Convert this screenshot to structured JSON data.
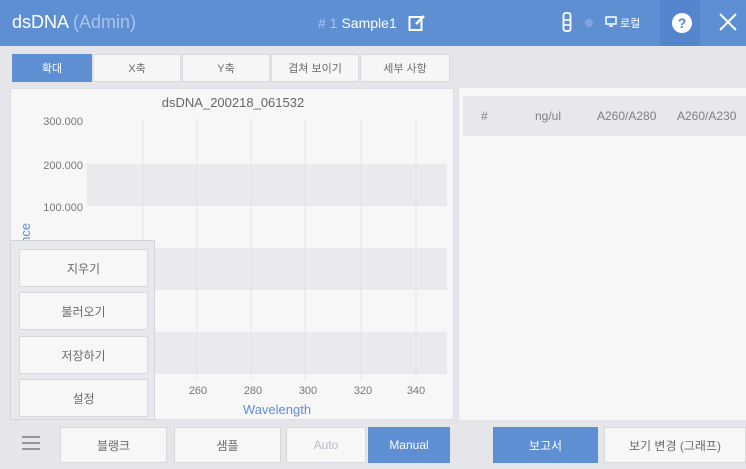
{
  "header": {
    "app_name": "dsDNA",
    "role": " (Admin)",
    "sample_number": "# 1",
    "sample_name": "Sample1",
    "remote_label": "로컬"
  },
  "toolbar": {
    "tabs": [
      {
        "label": "확대",
        "active": true
      },
      {
        "label": "X축",
        "active": false
      },
      {
        "label": "Y축",
        "active": false
      },
      {
        "label": "겹쳐 보이기",
        "active": false
      },
      {
        "label": "세부 사항",
        "active": false
      }
    ]
  },
  "chart_data": {
    "type": "line",
    "title": "dsDNA_200218_061532",
    "xlabel": "Wavelength",
    "ylabel": "ance",
    "x_ticks": [
      "260",
      "280",
      "300",
      "320",
      "340"
    ],
    "y_ticks": [
      "300.000",
      "200.000",
      "100.000"
    ],
    "grid": true,
    "series": []
  },
  "menu": {
    "items": [
      {
        "label": "지우기"
      },
      {
        "label": "불러오기"
      },
      {
        "label": "저장하기"
      },
      {
        "label": "설정"
      }
    ]
  },
  "table": {
    "columns": [
      "#",
      "ng/ul",
      "A260/A280",
      "A260/A230"
    ],
    "rows": []
  },
  "bottom": {
    "blank_label": "블랭크",
    "sample_label": "샘플",
    "auto_label": "Auto",
    "manual_label": "Manual",
    "report_label": "보고서",
    "view_change_label": "보기 변경 (그래프)"
  },
  "colors": {
    "accent": "#5f8fd3",
    "axis_text": "#5f8fd3"
  }
}
